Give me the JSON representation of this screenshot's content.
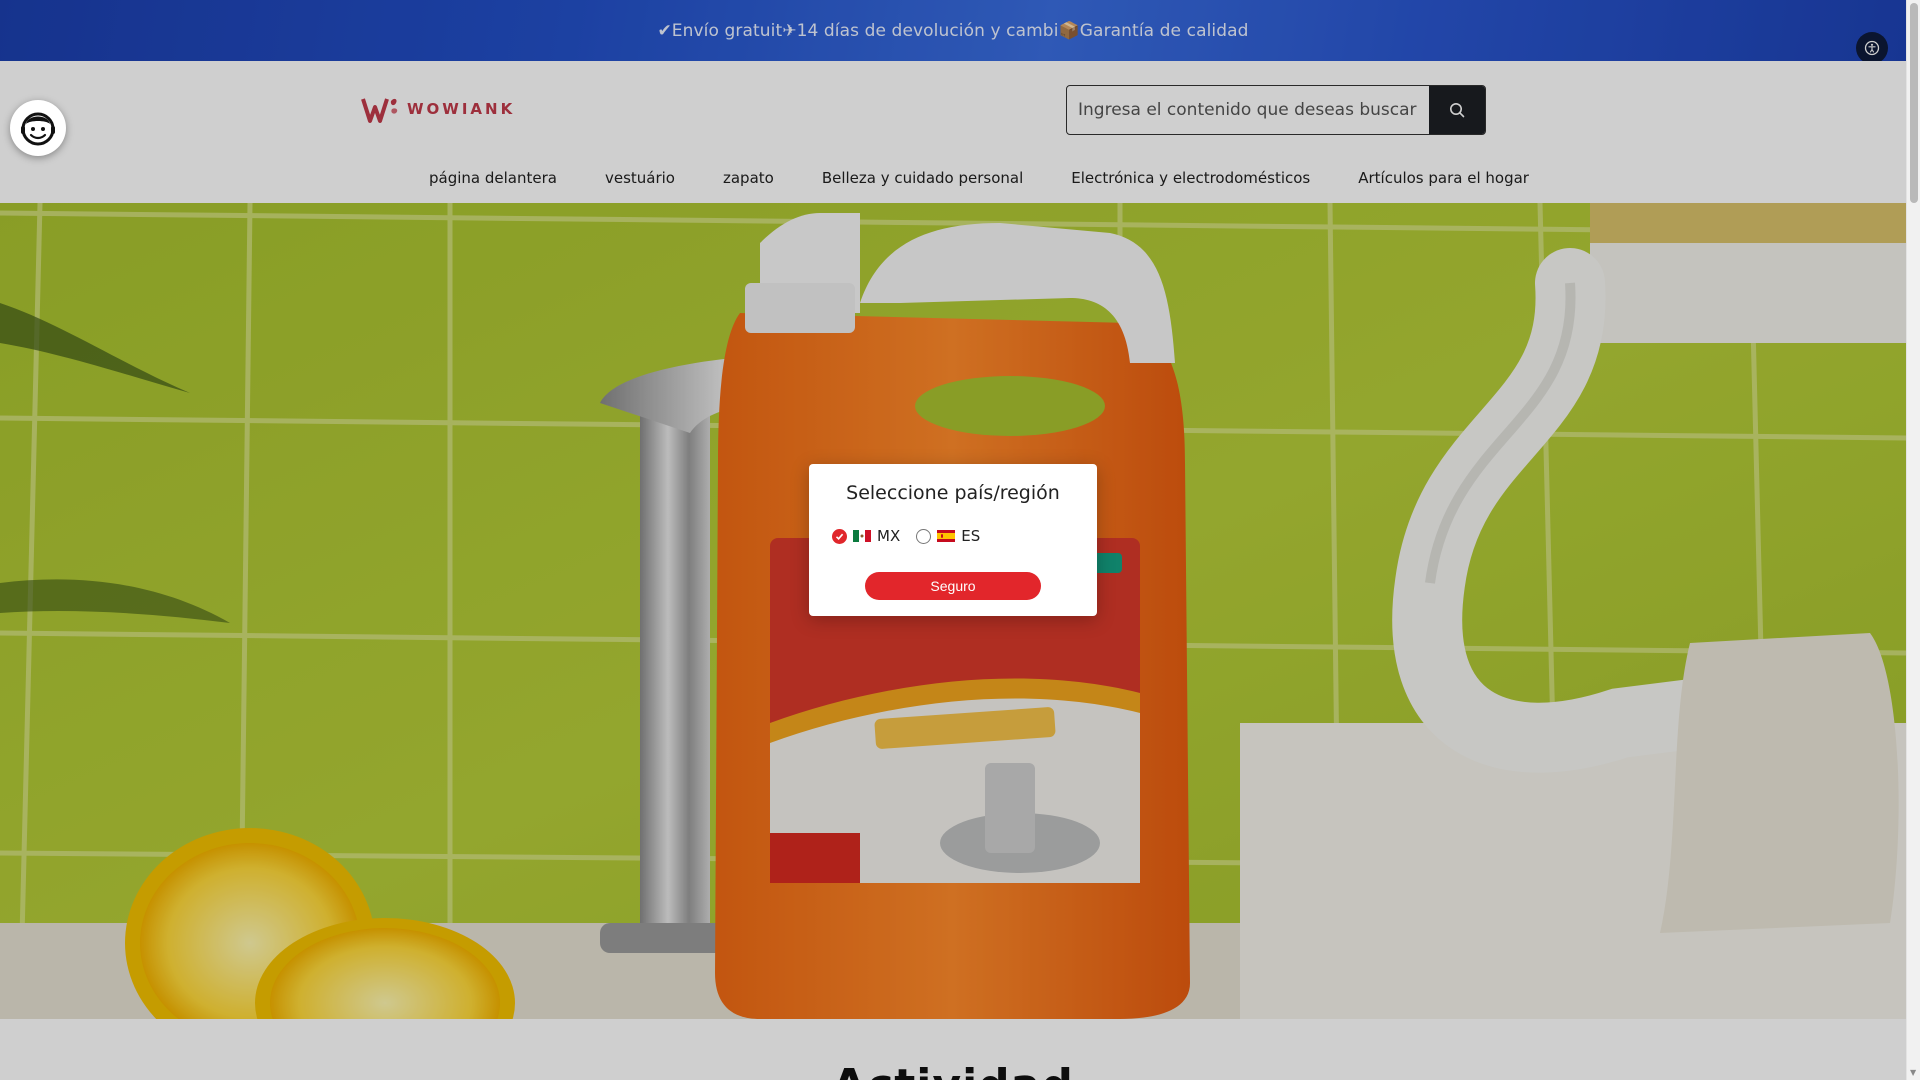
{
  "announcement": {
    "text": "✔Envío gratuit✈14 días de devolución y cambi📦Garantía de calidad"
  },
  "header": {
    "logo_text": "WOWIANK",
    "search_placeholder": "Ingresa el contenido que deseas buscar"
  },
  "nav": {
    "items": [
      {
        "label": "página delantera"
      },
      {
        "label": "vestuário"
      },
      {
        "label": "zapato"
      },
      {
        "label": "Belleza y cuidado personal"
      },
      {
        "label": "Electrónica y electrodomésticos"
      },
      {
        "label": "Artículos para el hogar"
      }
    ]
  },
  "modal": {
    "title": "Seleccione país/región",
    "options": [
      {
        "code": "MX",
        "selected": true
      },
      {
        "code": "ES",
        "selected": false
      }
    ],
    "confirm_label": "Seguro"
  },
  "section": {
    "title": "Actividad"
  },
  "colors": {
    "accent": "#e2262b",
    "announcement_bg": "#2350c8",
    "logo": "#c23a4a"
  },
  "icons": {
    "search": "search-icon",
    "accessibility": "accessibility-icon",
    "chat": "chat-avatar-icon"
  }
}
